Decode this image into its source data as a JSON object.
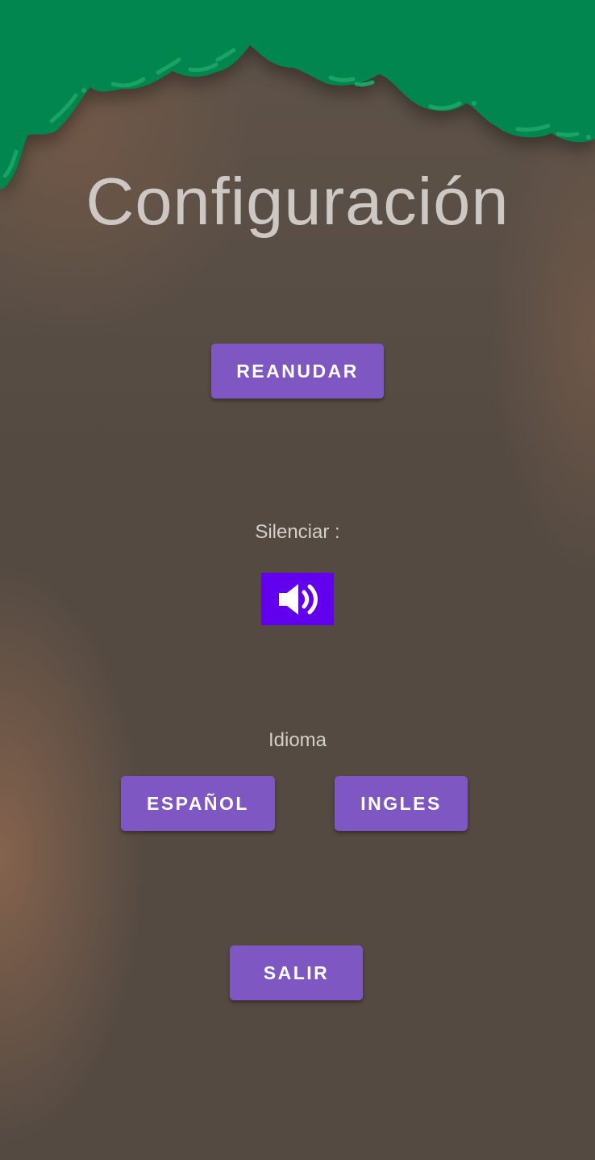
{
  "screen": {
    "title": "Configuración"
  },
  "actions": {
    "resume_label": "REANUDAR",
    "exit_label": "SALIR"
  },
  "sound": {
    "label": "Silenciar :",
    "icon": "volume-up-icon"
  },
  "language": {
    "label": "Idioma",
    "spanish_label": "ESPAÑOL",
    "english_label": "INGLES"
  },
  "colors": {
    "canopy": "#02864f",
    "button": "#7e57c2",
    "mute_button": "#6200ee",
    "text_light": "#cdc8c4"
  }
}
